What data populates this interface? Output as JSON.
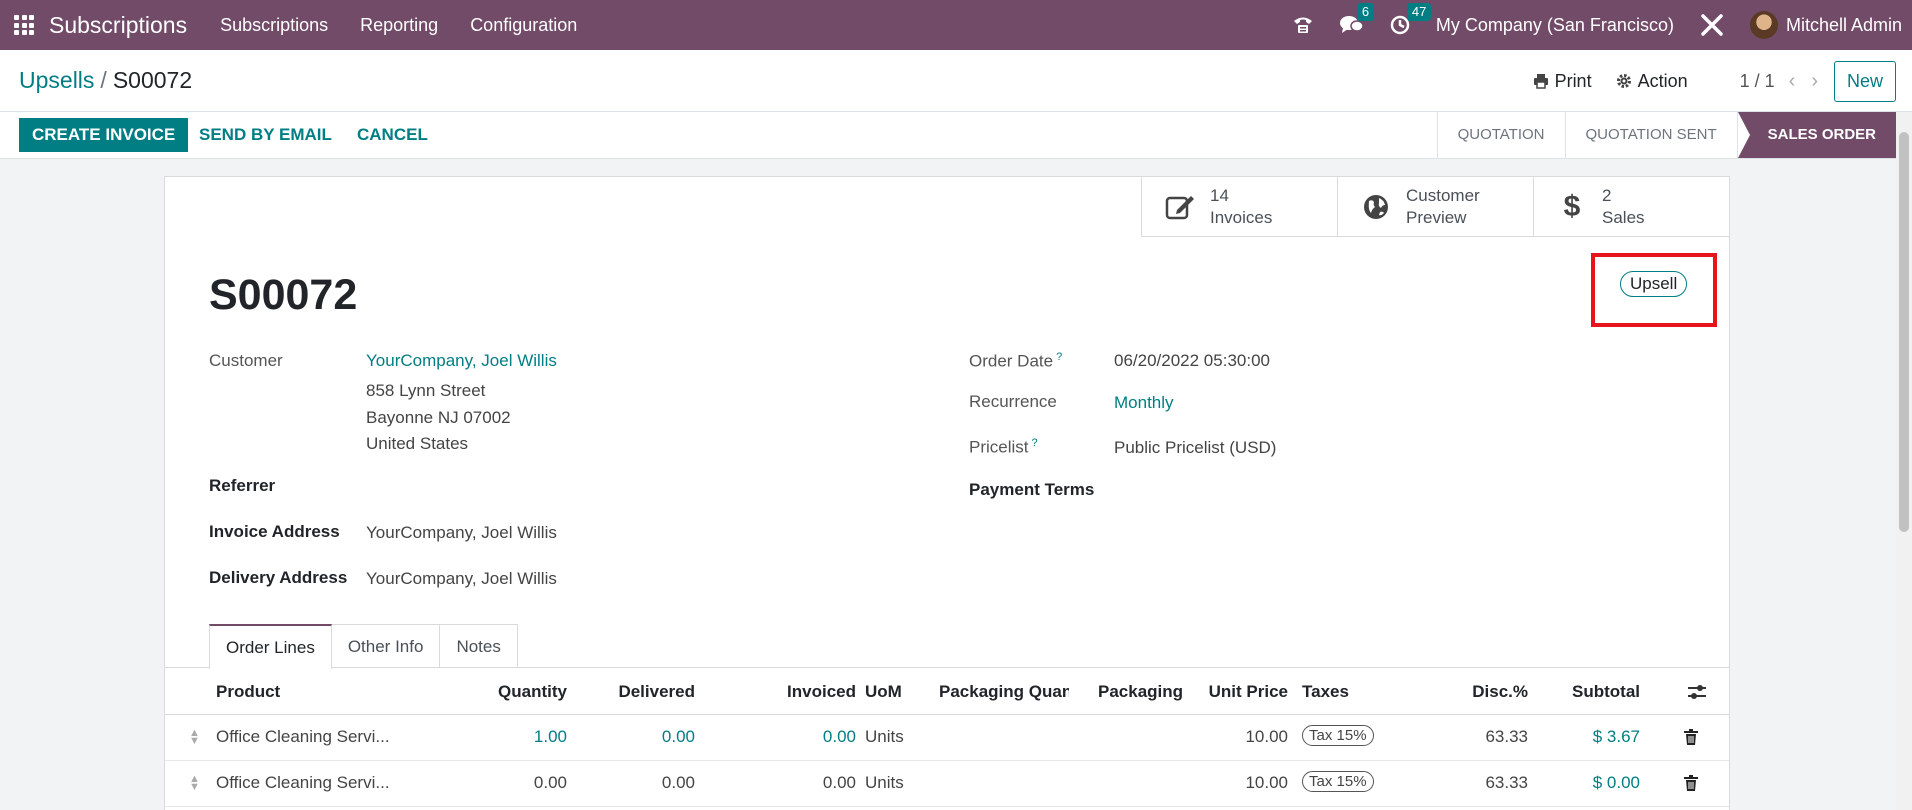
{
  "navbar": {
    "app_name": "Subscriptions",
    "menu": [
      "Subscriptions",
      "Reporting",
      "Configuration"
    ],
    "messages_count": "6",
    "activities_count": "47",
    "company": "My Company (San Francisco)",
    "user": "Mitchell Admin"
  },
  "breadcrumb": {
    "parent": "Upsells",
    "separator": "/",
    "current": "S00072"
  },
  "control": {
    "print": "Print",
    "action": "Action",
    "pager": "1 / 1",
    "new": "New"
  },
  "actions": {
    "create_invoice": "CREATE INVOICE",
    "send_email": "SEND BY EMAIL",
    "cancel": "CANCEL"
  },
  "stages": [
    "QUOTATION",
    "QUOTATION SENT",
    "SALES ORDER"
  ],
  "active_stage": "SALES ORDER",
  "smart_buttons": {
    "invoices": {
      "count": "14",
      "label": "Invoices"
    },
    "preview": {
      "line1": "Customer",
      "line2": "Preview"
    },
    "sales": {
      "count": "2",
      "label": "Sales"
    }
  },
  "record": {
    "name": "S00072",
    "tag": "Upsell",
    "customer_label": "Customer",
    "customer": "YourCompany, Joel Willis",
    "address_line1": "858 Lynn Street",
    "address_line2": "Bayonne NJ 07002",
    "address_line3": "United States",
    "referrer_label": "Referrer",
    "invoice_address_label": "Invoice Address",
    "invoice_address": "YourCompany, Joel Willis",
    "delivery_address_label": "Delivery Address",
    "delivery_address": "YourCompany, Joel Willis",
    "order_date_label": "Order Date",
    "order_date": "06/20/2022 05:30:00",
    "recurrence_label": "Recurrence",
    "recurrence": "Monthly",
    "pricelist_label": "Pricelist",
    "pricelist": "Public Pricelist (USD)",
    "payment_terms_label": "Payment Terms",
    "help_mark": "?"
  },
  "tabs": [
    "Order Lines",
    "Other Info",
    "Notes"
  ],
  "table": {
    "headers": [
      "Product",
      "Quantity",
      "Delivered",
      "Invoiced",
      "UoM",
      "Packaging Quan...",
      "Packaging",
      "Unit Price",
      "Taxes",
      "Disc.%",
      "Subtotal"
    ],
    "rows": [
      {
        "product": "Office Cleaning Servi...",
        "quantity": "1.00",
        "delivered": "0.00",
        "invoiced": "0.00",
        "uom": "Units",
        "unit_price": "10.00",
        "tax": "Tax 15%",
        "discount": "63.33",
        "subtotal": "$ 3.67"
      },
      {
        "product": "Office Cleaning Servi...",
        "quantity": "0.00",
        "delivered": "0.00",
        "invoiced": "0.00",
        "uom": "Units",
        "unit_price": "10.00",
        "tax": "Tax 15%",
        "discount": "63.33",
        "subtotal": "$ 0.00"
      }
    ]
  },
  "colors": {
    "brand": "#714b67",
    "accent": "#017e84",
    "highlight": "#e5151b"
  }
}
